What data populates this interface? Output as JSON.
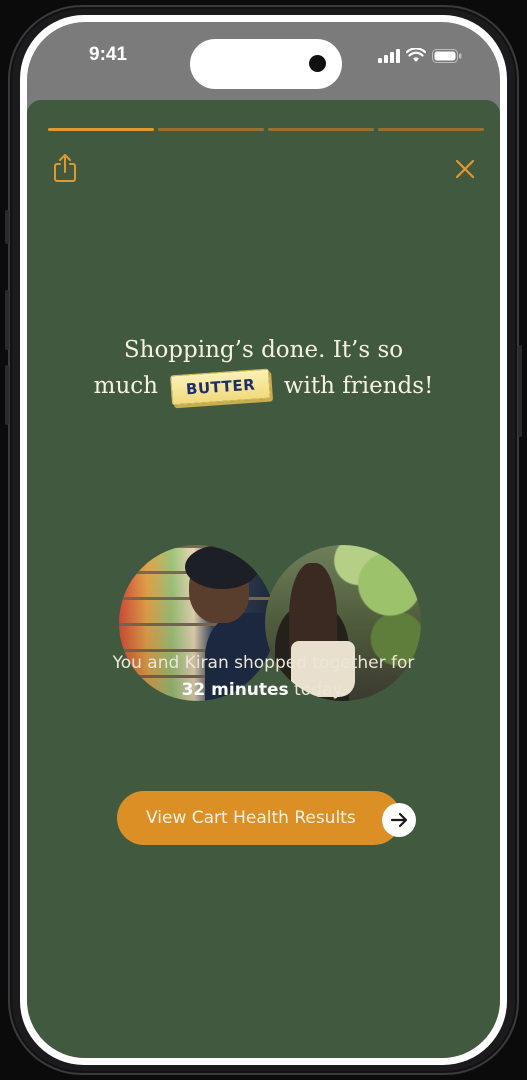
{
  "status_bar": {
    "time": "9:41",
    "icons": [
      "cellular-signal-icon",
      "wifi-icon",
      "battery-icon"
    ]
  },
  "story": {
    "progress": {
      "segments": 4,
      "active_index": 0
    },
    "share_icon": "share-icon",
    "close_icon": "close-icon",
    "headline": {
      "line1": "Shopping’s done. It’s so",
      "before_sticker": "much",
      "sticker_text": "BUTTER",
      "after_sticker": "with friends!"
    },
    "photos": [
      "shopper-photo-1",
      "shopper-photo-2"
    ],
    "summary": {
      "line1": "You and Kiran shopped together for",
      "duration": "32 minutes",
      "suffix": "today."
    },
    "cta": {
      "label": "View Cart Health Results",
      "icon": "arrow-right-icon"
    }
  },
  "colors": {
    "card_background": "#415a3f",
    "accent_orange": "#dc8f25",
    "progress_active": "#e3982e",
    "progress_inactive": "#97712f",
    "butter_text": "#1d2f66",
    "butter_fill": "#f1da7d"
  }
}
